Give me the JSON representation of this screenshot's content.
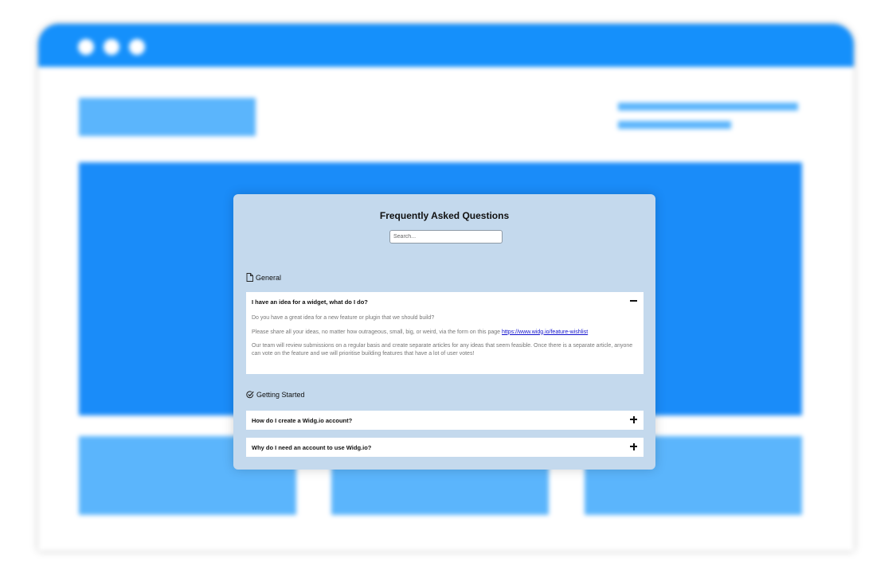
{
  "faq": {
    "title": "Frequently Asked Questions",
    "search_placeholder": "Search...",
    "sections": [
      {
        "name": "General",
        "icon": "document-icon",
        "questions": [
          {
            "question": "I have an idea for a widget, what do I do?",
            "expanded": true,
            "answer_p1": "Do you have a great idea for a new feature or plugin that we should build?",
            "answer_p2_text": "Please share all your ideas, no matter how outrageous, small, big, or weird, via the form on this page",
            "answer_p2_link": "https://www.widg.io/feature-wishlist",
            "answer_p3": "Our team will review submissions on a regular basis and create separate articles for any ideas that seem feasible. Once there is a separate article, anyone can vote on the feature and we will prioritise building features that have a lot of user votes!"
          }
        ]
      },
      {
        "name": "Getting Started",
        "icon": "check-circle-icon",
        "questions": [
          {
            "question": "How do I create a Widg.io account?",
            "expanded": false
          },
          {
            "question": "Why do I need an account to use Widg.io?",
            "expanded": false
          }
        ]
      }
    ]
  },
  "colors": {
    "browser_bar": "#1590fb",
    "hero": "#1a8cf9",
    "placeholder_block": "#5bb5fc",
    "widget_bg": "#c4d9ed",
    "link": "#1111cc"
  }
}
